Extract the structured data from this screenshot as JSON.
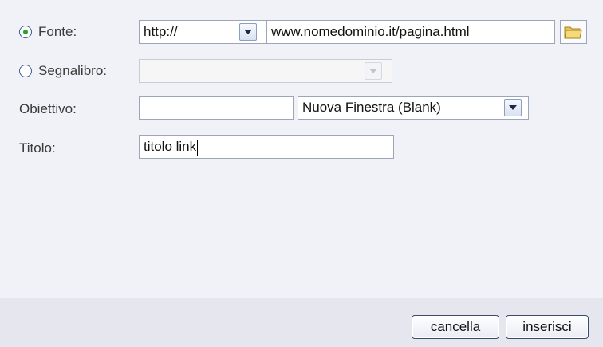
{
  "form": {
    "fonte": {
      "label": "Fonte:",
      "selected": true,
      "protocol": "http://",
      "url": "www.nomedominio.it/pagina.html",
      "browse_icon": "folder-icon"
    },
    "segnalibro": {
      "label": "Segnalibro:",
      "selected": false,
      "value": ""
    },
    "obiettivo": {
      "label": "Obiettivo:",
      "value": "",
      "target_option": "Nuova Finestra (Blank)"
    },
    "titolo": {
      "label": "Titolo:",
      "value": "titolo link"
    }
  },
  "footer": {
    "cancel_label": "cancella",
    "insert_label": "inserisci"
  },
  "colors": {
    "background": "#f1f2f8",
    "footer": "#e6e7ee",
    "radio_selected": "#2aa12a"
  }
}
